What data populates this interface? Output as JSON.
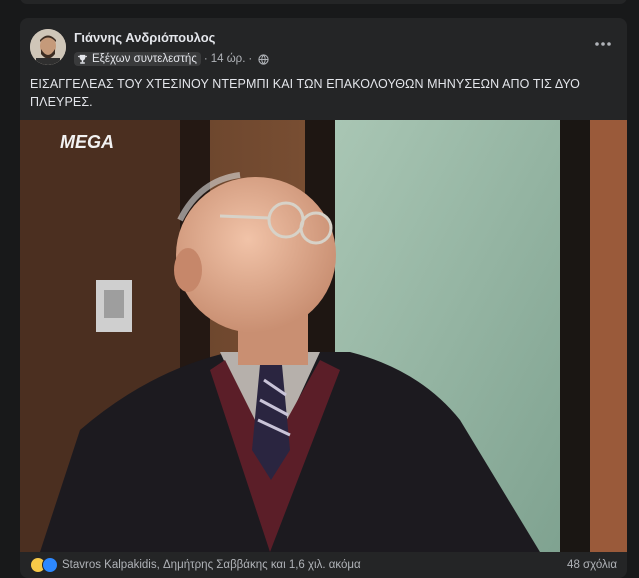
{
  "post": {
    "author": "Γιάννης Ανδριόπουλος",
    "badge_label": "Εξέχων συντελεστής",
    "time": "14 ώρ.",
    "dot": "·",
    "text": "ΕΙΣΑΓΓΕΛΕΑΣ ΤΟΥ ΧΤΕΣΙΝΟΥ ΝΤΕΡΜΠΙ ΚΑΙ ΤΩΝ ΕΠΑΚΟΛΟΥΘΩΝ ΜΗΝΥΣΕΩΝ ΑΠΟ ΤΙΣ ΔΥΟ ΠΛΕΥΡΕΣ.",
    "media_watermark": "MEGA",
    "reactions_text": "Stavros Kalpakidis, Δημήτρης Σαββάκης και 1,6 χιλ. ακόμα",
    "comments_count": "48 σχόλια"
  },
  "icons": {
    "more": "more-options-icon",
    "trophy": "trophy-icon",
    "globe": "globe-icon",
    "haha": "haha-reaction-icon",
    "like": "like-reaction-icon"
  },
  "colors": {
    "background": "#18191a",
    "card": "#242526",
    "text_primary": "#e4e6eb",
    "text_secondary": "#b0b3b8",
    "like_blue": "#2d88ff",
    "haha_yellow": "#f7c948"
  }
}
